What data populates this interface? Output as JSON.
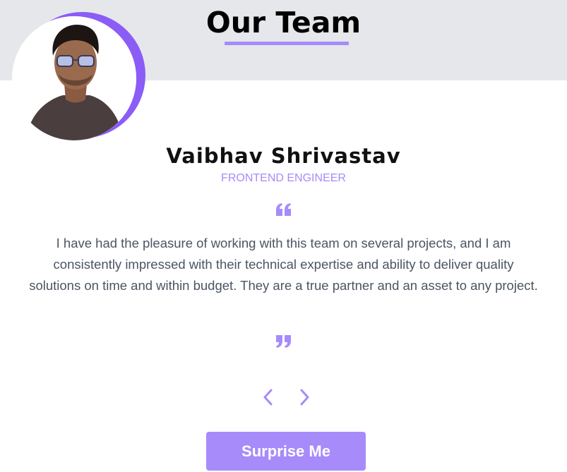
{
  "header": {
    "title": "Our Team"
  },
  "member": {
    "name": "Vaibhav Shrivastav",
    "role": "FRONTEND ENGINEER",
    "testimonial": "I have had the pleasure of working with this team on several projects, and I am consistently impressed with their technical expertise and ability to deliver quality solutions on time and within budget. They are a true partner and an asset to any project."
  },
  "icons": {
    "open_quote": "quote-left-icon",
    "close_quote": "quote-right-icon",
    "prev": "chevron-left-icon",
    "next": "chevron-right-icon"
  },
  "actions": {
    "surprise_label": "Surprise Me"
  },
  "colors": {
    "accent": "#a78bfa",
    "ring": "#8b5cf6",
    "band": "#e5e7eb",
    "text": "#4b5563"
  }
}
